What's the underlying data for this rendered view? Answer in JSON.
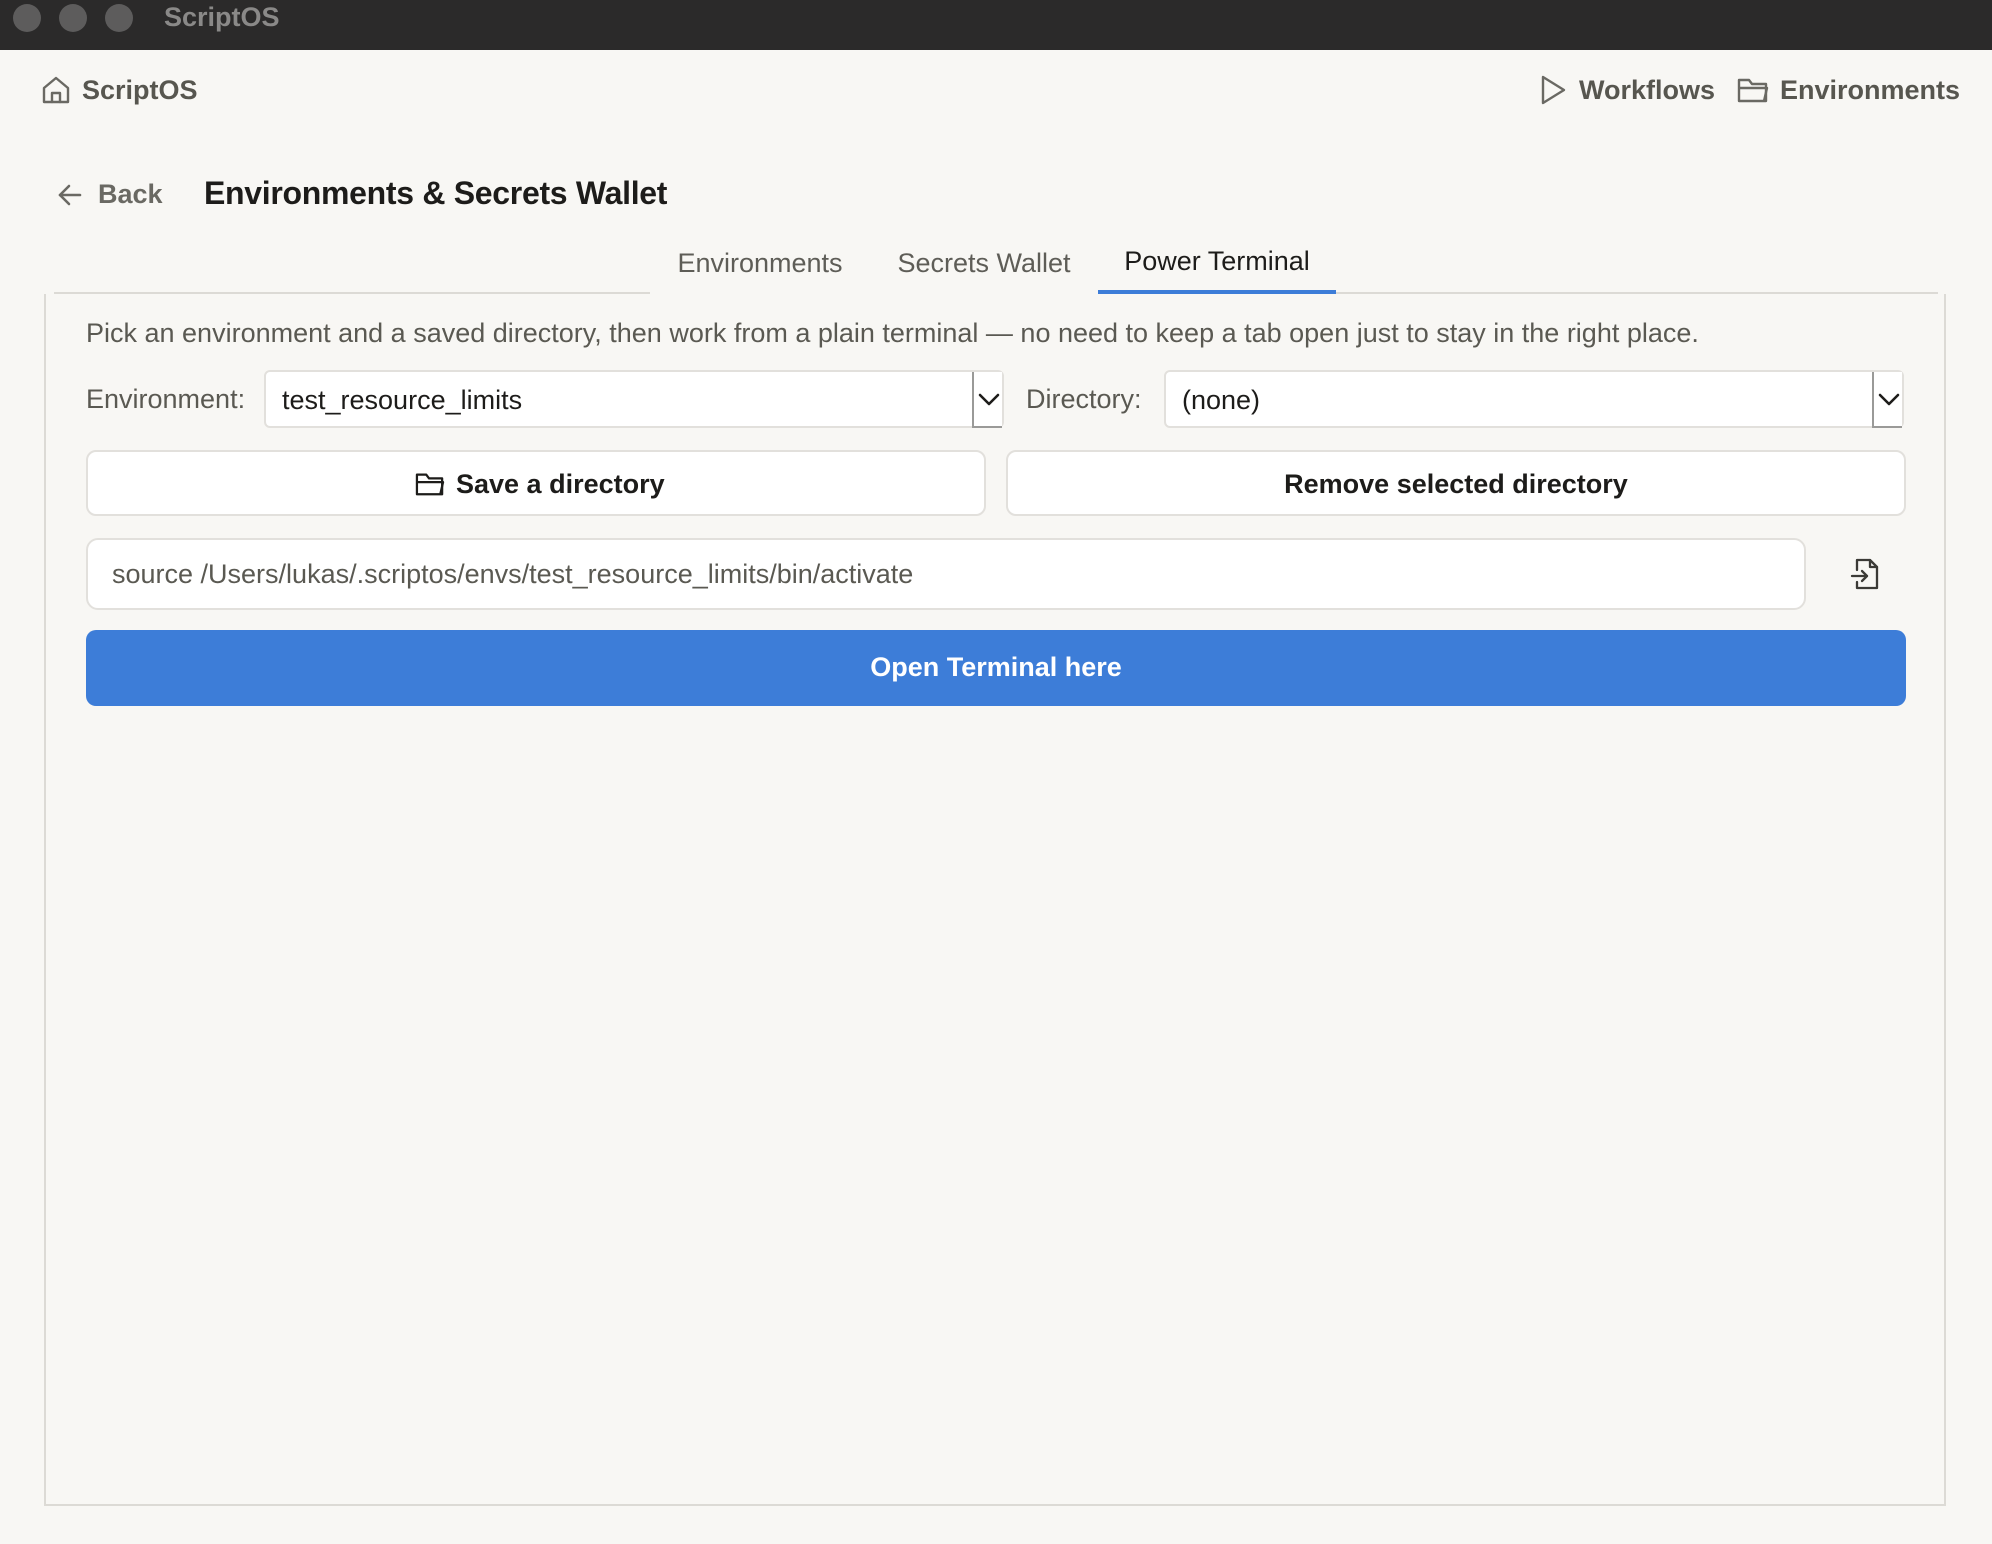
{
  "window": {
    "title": "ScriptOS"
  },
  "nav": {
    "home_label": "ScriptOS",
    "workflows_label": "Workflows",
    "environments_label": "Environments"
  },
  "header": {
    "back_label": "Back",
    "title": "Environments & Secrets Wallet"
  },
  "tabs": [
    {
      "label": "Environments",
      "active": false
    },
    {
      "label": "Secrets Wallet",
      "active": false
    },
    {
      "label": "Power Terminal",
      "active": true
    }
  ],
  "power_terminal": {
    "description": "Pick an environment and a saved directory, then work from a plain terminal — no need to keep a tab open just to stay in the right place.",
    "environment_label": "Environment:",
    "environment_value": "test_resource_limits",
    "directory_label": "Directory:",
    "directory_value": "(none)",
    "save_dir_label": "Save a directory",
    "remove_dir_label": "Remove selected directory",
    "command": "source /Users/lukas/.scriptos/envs/test_resource_limits/bin/activate",
    "open_terminal_label": "Open Terminal here"
  },
  "colors": {
    "accent": "#3d7dd8",
    "background": "#f8f7f4",
    "titlebar": "#2b2a2a"
  },
  "icons": [
    "home-icon",
    "play-icon",
    "folder-icon",
    "arrow-left-icon",
    "chevron-down-icon",
    "copy-to-file-icon"
  ]
}
